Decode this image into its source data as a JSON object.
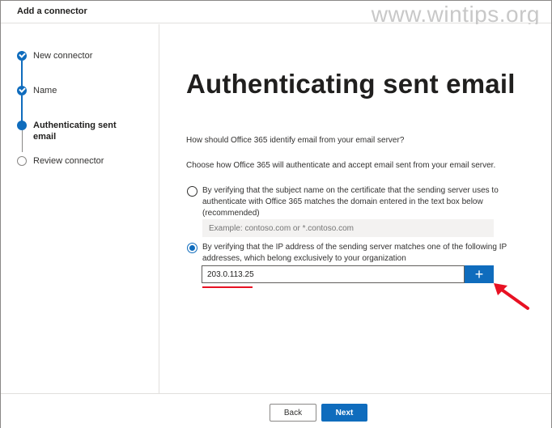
{
  "window": {
    "title": "Add a connector",
    "watermark": "www.wintips.org"
  },
  "steps": [
    {
      "label": "New connector",
      "state": "done"
    },
    {
      "label": "Name",
      "state": "done"
    },
    {
      "label": "Authenticating sent email",
      "state": "current"
    },
    {
      "label": "Review connector",
      "state": "todo"
    }
  ],
  "main": {
    "heading": "Authenticating sent email",
    "question": "How should Office 365 identify email from your email server?",
    "instruction": "Choose how Office 365 will authenticate and accept email sent from your email server.",
    "option_certificate": {
      "label": "By verifying that the subject name on the certificate that the sending server uses to authenticate with Office 365 matches the domain entered in the text box below (recommended)",
      "placeholder": "Example: contoso.com or *.contoso.com",
      "selected": false
    },
    "option_ip": {
      "label": "By verifying that the IP address of the sending server matches one of the following IP addresses, which belong exclusively to your organization",
      "value": "203.0.113.25",
      "selected": true,
      "add_label": "+"
    }
  },
  "footer": {
    "back_label": "Back",
    "next_label": "Next"
  },
  "colors": {
    "accent": "#0f6cbd",
    "annotation": "#e81123"
  }
}
